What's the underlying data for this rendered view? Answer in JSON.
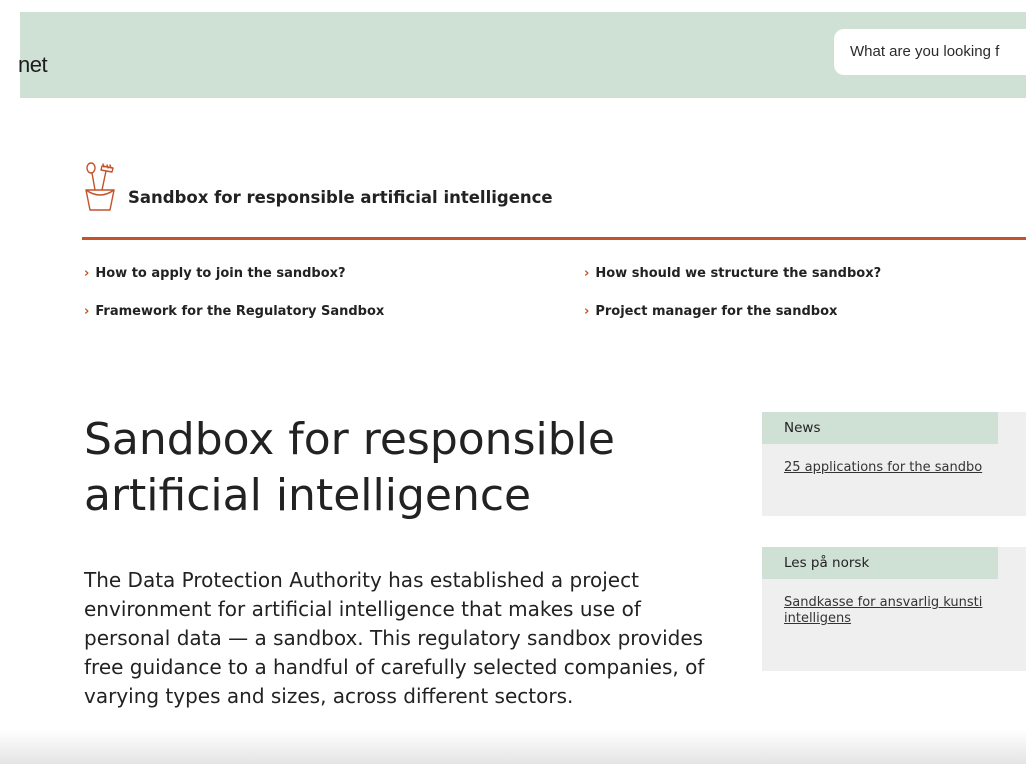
{
  "header": {
    "brand": "net",
    "search_placeholder": "What are you looking f"
  },
  "section": {
    "icon": "sandbox-bucket-icon",
    "title": "Sandbox for responsible artificial intelligence",
    "rule_color": "#c4522a"
  },
  "quick_links": [
    {
      "label": "How to apply to join the sandbox?"
    },
    {
      "label": "How should we structure the sandbox?"
    },
    {
      "label": "Framework for the Regulatory Sandbox"
    },
    {
      "label": "Project manager for the sandbox"
    }
  ],
  "main": {
    "title": "Sandbox for responsible artificial intelligence",
    "lead": "The Data Protection Authority has established a project environment for artificial intelligence that makes use of personal data — a sandbox. This regulatory sandbox provides free guidance to a handful of carefully selected companies, of varying types and sizes, across different sectors."
  },
  "sidebar": {
    "news": {
      "tag": "News",
      "link": "25 applications for the sandbo"
    },
    "norwegian": {
      "tag": "Les på norsk",
      "link": "Sandkasse for ansvarlig kunsti intelligens"
    }
  },
  "colors": {
    "header_bg": "#cfe0d5",
    "accent": "#c4522a",
    "sidebar_bg": "#efefef"
  }
}
